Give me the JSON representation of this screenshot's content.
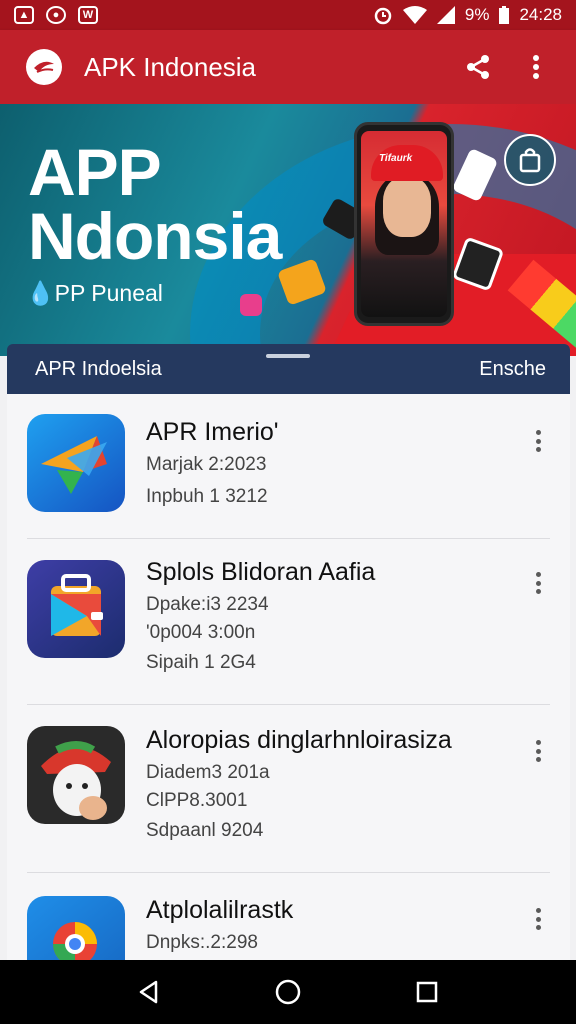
{
  "status_bar": {
    "time": "24:28",
    "battery": "9%",
    "left_icons": [
      "fire-icon",
      "location-icon",
      "app-icon"
    ],
    "right_icons": [
      "alarm-icon",
      "wifi-icon",
      "signal-icon",
      "battery-icon"
    ]
  },
  "app_bar": {
    "title": "APK Indonesia",
    "actions": [
      "share-icon",
      "more-vert-icon"
    ]
  },
  "banner": {
    "title_line1": "APP",
    "title_line2": "Ndonsia",
    "subtitle": "PP Puneal",
    "phone_screen_text": "Tifaurk"
  },
  "sheet": {
    "title": "APR Indoelsia",
    "action": "Ensche"
  },
  "apps": [
    {
      "title": "APR Imerio'",
      "lines": [
        "Marjak 2:2023",
        "Inpbuh 1 3212"
      ]
    },
    {
      "title": "Splols Blidoran Aafia",
      "lines": [
        "Dpake:i3 2234",
        "'0p004 3:00n",
        "Sipaih 1 2G4"
      ]
    },
    {
      "title": "Aloropias dinglarhnloirasiza",
      "lines": [
        "Diadem3 201a",
        "ClPP8.3001",
        "Sdpaanl 9204"
      ]
    },
    {
      "title": "Atplolalilrastk",
      "lines": [
        "Dnpks:.2:298"
      ]
    }
  ],
  "colors": {
    "status_bar": "#a4141d",
    "app_bar": "#c0202a",
    "sheet_header": "#25395f",
    "navbar": "#000000"
  },
  "nav": [
    "back-icon",
    "home-icon",
    "recents-icon"
  ]
}
